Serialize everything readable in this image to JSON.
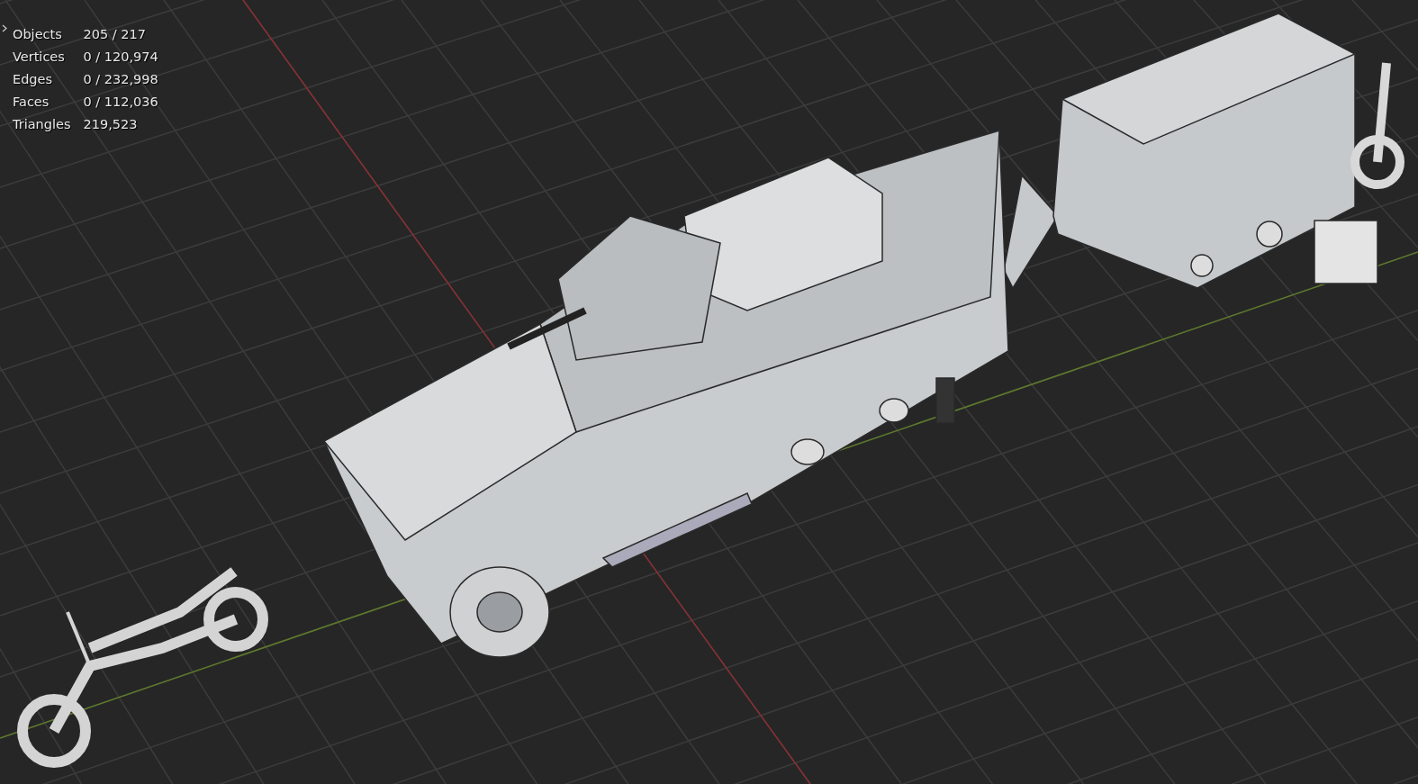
{
  "viewport": {
    "stats": [
      {
        "label": "Objects",
        "value": "205 / 217"
      },
      {
        "label": "Vertices",
        "value": "0 / 120,974"
      },
      {
        "label": "Edges",
        "value": "0 / 232,998"
      },
      {
        "label": "Faces",
        "value": "0 / 112,036"
      },
      {
        "label": "Triangles",
        "value": "219,523"
      }
    ]
  }
}
